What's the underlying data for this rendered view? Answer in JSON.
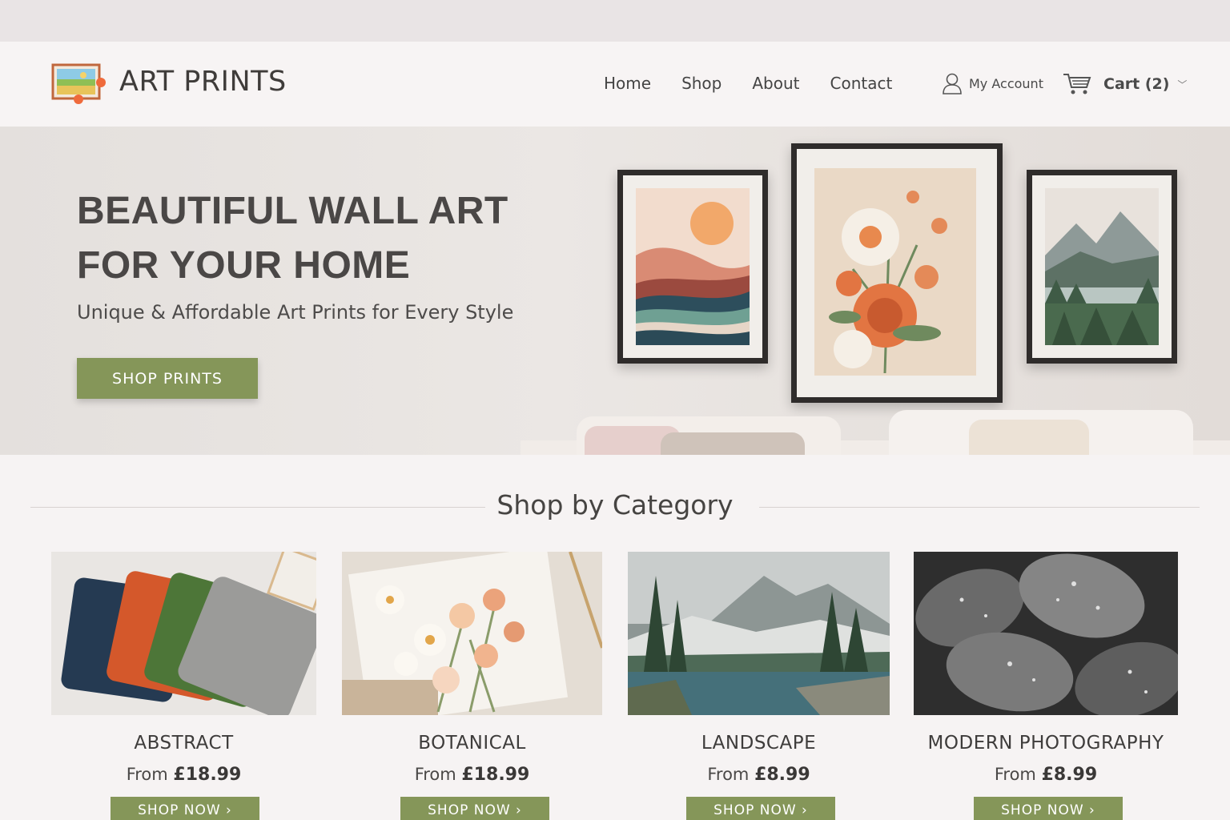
{
  "brand": {
    "name": "ART PRINTS"
  },
  "nav": {
    "items": [
      "Home",
      "Shop",
      "About",
      "Contact"
    ]
  },
  "account": {
    "label": "My Account"
  },
  "cart": {
    "label": "Cart (2)"
  },
  "hero": {
    "title_line1": "BEAUTIFUL WALL ART",
    "title_line2": "FOR YOUR HOME",
    "subtitle": "Unique & Affordable Art Prints for Every Style",
    "button": "SHOP PRINTS"
  },
  "categories": {
    "title": "Shop by Category",
    "items": [
      {
        "name": "ABSTRACT",
        "from": "From",
        "price": "£18.99",
        "button": "SHOP NOW ›"
      },
      {
        "name": "BOTANICAL",
        "from": "From",
        "price": "£18.99",
        "button": "SHOP NOW ›"
      },
      {
        "name": "LANDSCAPE",
        "from": "From",
        "price": "£8.99",
        "button": "SHOP NOW ›"
      },
      {
        "name": "MODERN PHOTOGRAPHY",
        "from": "From",
        "price": "£8.99",
        "button": "SHOP NOW ›"
      }
    ]
  },
  "colors": {
    "accent": "#859659",
    "header_bg": "#f7f4f4",
    "text": "#3e3d3c"
  }
}
